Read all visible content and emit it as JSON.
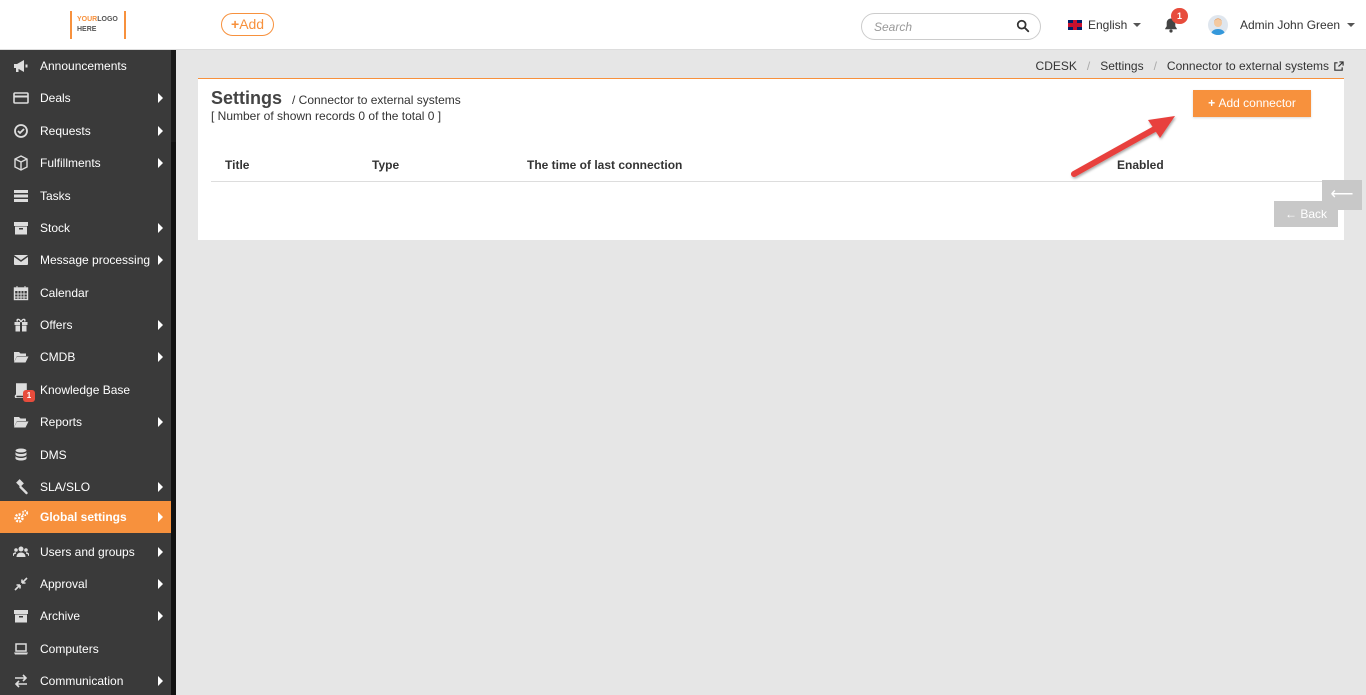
{
  "header": {
    "logo_line1_a": "YOUR",
    "logo_line1_b": "LOGO",
    "logo_line2": "HERE",
    "add_label": "Add",
    "search_placeholder": "Search",
    "language": "English",
    "notifications_count": "1",
    "user_name": "Admin John Green"
  },
  "sidebar": {
    "items": [
      {
        "label": "Announcements",
        "icon": "bullhorn-icon",
        "has_submenu": false
      },
      {
        "label": "Deals",
        "icon": "credit-card-icon",
        "has_submenu": true
      },
      {
        "label": "Requests",
        "icon": "check-circle-icon",
        "has_submenu": true
      },
      {
        "label": "Fulfillments",
        "icon": "cube-icon",
        "has_submenu": true
      },
      {
        "label": "Tasks",
        "icon": "tasks-icon",
        "has_submenu": false
      },
      {
        "label": "Stock",
        "icon": "archive-box-icon",
        "has_submenu": true
      },
      {
        "label": "Message processing",
        "icon": "envelope-icon",
        "has_submenu": true
      },
      {
        "label": "Calendar",
        "icon": "calendar-icon",
        "has_submenu": false
      },
      {
        "label": "Offers",
        "icon": "gift-icon",
        "has_submenu": true
      },
      {
        "label": "CMDB",
        "icon": "folder-open-icon",
        "has_submenu": true
      },
      {
        "label": "Knowledge Base",
        "icon": "book-icon",
        "has_submenu": false,
        "badge": "1"
      },
      {
        "label": "Reports",
        "icon": "folder-open-icon",
        "has_submenu": true
      },
      {
        "label": "DMS",
        "icon": "database-icon",
        "has_submenu": false
      },
      {
        "label": "SLA/SLO",
        "icon": "gavel-icon",
        "has_submenu": true
      },
      {
        "label": "Global settings",
        "icon": "cogs-icon",
        "has_submenu": true,
        "active": true
      },
      {
        "label": "Users and groups",
        "icon": "users-icon",
        "has_submenu": true
      },
      {
        "label": "Approval",
        "icon": "compress-icon",
        "has_submenu": true
      },
      {
        "label": "Archive",
        "icon": "archive-box-icon",
        "has_submenu": true
      },
      {
        "label": "Computers",
        "icon": "laptop-icon",
        "has_submenu": false
      },
      {
        "label": "Communication",
        "icon": "exchange-icon",
        "has_submenu": true
      }
    ]
  },
  "breadcrumb": {
    "items": [
      "CDESK",
      "Settings",
      "Connector to external systems"
    ]
  },
  "main": {
    "title": "Settings",
    "subtitle": "/ Connector to external systems",
    "records_text": "[ Number of shown records 0 of the total 0 ]",
    "add_connector_label": "Add connector",
    "columns": [
      "Title",
      "Type",
      "The time of last connection",
      "Enabled"
    ],
    "back_label": "Back"
  },
  "colors": {
    "accent": "#f7913d",
    "sidebar_bg": "#3a3a3a",
    "badge": "#e74c3c",
    "arrow": "#e8413c"
  }
}
